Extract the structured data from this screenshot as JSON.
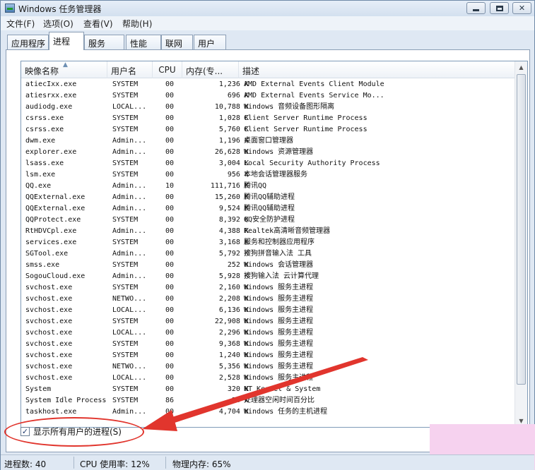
{
  "window": {
    "title": "Windows 任务管理器",
    "buttons": {
      "minimize": "",
      "maximize": "",
      "close": "✕"
    }
  },
  "menu": [
    "文件(F)",
    "选项(O)",
    "查看(V)",
    "帮助(H)"
  ],
  "tabs": [
    "应用程序",
    "进程",
    "服务",
    "性能",
    "联网",
    "用户"
  ],
  "active_tab": "进程",
  "columns": [
    "映像名称",
    "用户名",
    "CPU",
    "内存(专...",
    "描述"
  ],
  "processes": [
    {
      "name": "atiecIxx.exe",
      "user": "SYSTEM",
      "cpu": "00",
      "mem": "1,236 K",
      "desc": "AMD External Events Client Module"
    },
    {
      "name": "atiesrxx.exe",
      "user": "SYSTEM",
      "cpu": "00",
      "mem": "696 K",
      "desc": "AMD External Events Service Mo..."
    },
    {
      "name": "audiodg.exe",
      "user": "LOCAL...",
      "cpu": "00",
      "mem": "10,788 K",
      "desc": "Windows 音频设备图形隔离"
    },
    {
      "name": "csrss.exe",
      "user": "SYSTEM",
      "cpu": "00",
      "mem": "1,028 K",
      "desc": "Client Server Runtime Process"
    },
    {
      "name": "csrss.exe",
      "user": "SYSTEM",
      "cpu": "00",
      "mem": "5,760 K",
      "desc": "Client Server Runtime Process"
    },
    {
      "name": "dwm.exe",
      "user": "Admin...",
      "cpu": "00",
      "mem": "1,196 K",
      "desc": "桌面窗口管理器"
    },
    {
      "name": "explorer.exe",
      "user": "Admin...",
      "cpu": "00",
      "mem": "26,628 K",
      "desc": "Windows 资源管理器"
    },
    {
      "name": "lsass.exe",
      "user": "SYSTEM",
      "cpu": "00",
      "mem": "3,004 K",
      "desc": "Local Security Authority Process"
    },
    {
      "name": "lsm.exe",
      "user": "SYSTEM",
      "cpu": "00",
      "mem": "956 K",
      "desc": "本地会话管理器服务"
    },
    {
      "name": "QQ.exe",
      "user": "Admin...",
      "cpu": "10",
      "mem": "111,716 K",
      "desc": "腾讯QQ"
    },
    {
      "name": "QQExternal.exe",
      "user": "Admin...",
      "cpu": "00",
      "mem": "15,260 K",
      "desc": "腾讯QQ辅助进程"
    },
    {
      "name": "QQExternal.exe",
      "user": "Admin...",
      "cpu": "00",
      "mem": "9,524 K",
      "desc": "腾讯QQ辅助进程"
    },
    {
      "name": "QQProtect.exe",
      "user": "SYSTEM",
      "cpu": "00",
      "mem": "8,392 K",
      "desc": "QQ安全防护进程"
    },
    {
      "name": "RtHDVCpl.exe",
      "user": "Admin...",
      "cpu": "00",
      "mem": "4,388 K",
      "desc": "Realtek高清晰音频管理器"
    },
    {
      "name": "services.exe",
      "user": "SYSTEM",
      "cpu": "00",
      "mem": "3,168 K",
      "desc": "服务和控制器应用程序"
    },
    {
      "name": "SGTool.exe",
      "user": "Admin...",
      "cpu": "00",
      "mem": "5,792 K",
      "desc": "搜狗拼音输入法 工具"
    },
    {
      "name": "smss.exe",
      "user": "SYSTEM",
      "cpu": "00",
      "mem": "252 K",
      "desc": "Windows 会话管理器"
    },
    {
      "name": "SogouCloud.exe",
      "user": "Admin...",
      "cpu": "00",
      "mem": "5,928 K",
      "desc": "搜狗输入法 云计算代理"
    },
    {
      "name": "svchost.exe",
      "user": "SYSTEM",
      "cpu": "00",
      "mem": "2,160 K",
      "desc": "Windows 服务主进程"
    },
    {
      "name": "svchost.exe",
      "user": "NETWO...",
      "cpu": "00",
      "mem": "2,208 K",
      "desc": "Windows 服务主进程"
    },
    {
      "name": "svchost.exe",
      "user": "LOCAL...",
      "cpu": "00",
      "mem": "6,136 K",
      "desc": "Windows 服务主进程"
    },
    {
      "name": "svchost.exe",
      "user": "SYSTEM",
      "cpu": "00",
      "mem": "22,908 K",
      "desc": "Windows 服务主进程"
    },
    {
      "name": "svchost.exe",
      "user": "LOCAL...",
      "cpu": "00",
      "mem": "2,296 K",
      "desc": "Windows 服务主进程"
    },
    {
      "name": "svchost.exe",
      "user": "SYSTEM",
      "cpu": "00",
      "mem": "9,368 K",
      "desc": "Windows 服务主进程"
    },
    {
      "name": "svchost.exe",
      "user": "SYSTEM",
      "cpu": "00",
      "mem": "1,240 K",
      "desc": "Windows 服务主进程"
    },
    {
      "name": "svchost.exe",
      "user": "NETWO...",
      "cpu": "00",
      "mem": "5,356 K",
      "desc": "Windows 服务主进程"
    },
    {
      "name": "svchost.exe",
      "user": "LOCAL...",
      "cpu": "00",
      "mem": "2,528 K",
      "desc": "Windows 服务主进程"
    },
    {
      "name": "System",
      "user": "SYSTEM",
      "cpu": "00",
      "mem": "320 K",
      "desc": "NT Kernel & System"
    },
    {
      "name": "System Idle Process",
      "user": "SYSTEM",
      "cpu": "86",
      "mem": "24 K",
      "desc": "处理器空闲时间百分比"
    },
    {
      "name": "taskhost.exe",
      "user": "Admin...",
      "cpu": "00",
      "mem": "4,704 K",
      "desc": "Windows 任务的主机进程"
    }
  ],
  "show_all_users": {
    "label": "显示所有用户的进程(S)",
    "checked_mark": "✓"
  },
  "status": {
    "processes": "进程数: 40",
    "cpu": "CPU 使用率: 12%",
    "memory": "物理内存: 65%"
  },
  "colors": {
    "annotation": "#e1352d",
    "accent": "#6f8aa8"
  }
}
